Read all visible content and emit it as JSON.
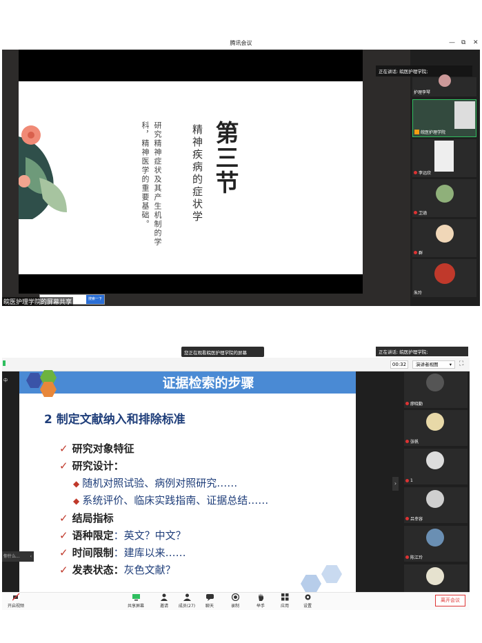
{
  "top_window": {
    "title": "腾讯会议",
    "window_controls": [
      "—",
      "⧉",
      "✕"
    ],
    "share_label": "皖医护理学院的屏幕共享",
    "mini_search_button": "搜索一下",
    "speaking": "正在讲话: 皖医护理学院;",
    "slide": {
      "chapter": "第三节",
      "title": "精神疾病的症状学",
      "description": "研究精神症状及其产生机制的学科，精神医学的重要基础。"
    },
    "participants": [
      {
        "name": "护理李琴"
      },
      {
        "name": "皖医护理学院"
      },
      {
        "name": "李远欣"
      },
      {
        "name": "卫涵"
      },
      {
        "name": "群"
      },
      {
        "name": "朱玲"
      }
    ]
  },
  "bottom_window": {
    "viewing_banner": "您正在观看皖医护理学院的屏幕",
    "speaking": "正在讲话: 皖医护理学院;",
    "timer": "00:32",
    "view_mode": "演讲者视图",
    "left_label": "中",
    "left_toast": "你什么...",
    "slide": {
      "header": "证据检索的步骤",
      "subtitle": "2 制定文献纳入和排除标准",
      "bullets": {
        "b1": "研究对象特征",
        "b2": "研究设计：",
        "b2a": "随机对照试验、病例对照研究……",
        "b2b": "系统评价、临床实践指南、证据总结……",
        "b3": "结局指标",
        "b4_label": "语种限定",
        "b4_value": "：英文？中文？",
        "b5_label": "时间限制",
        "b5_value": "：建库以来……",
        "b6_label": "发表状态：",
        "b6_value": "灰色文献？"
      }
    },
    "participants": [
      {
        "name": "廖晓勤"
      },
      {
        "name": "张帆"
      },
      {
        "name": "1"
      },
      {
        "name": "吕幸容"
      },
      {
        "name": "陈江玲"
      },
      {
        "name": ""
      }
    ],
    "toolbar": {
      "video": "开启视频",
      "share": "共享屏幕",
      "invite": "邀请",
      "members": "成员(27)",
      "chat": "聊天",
      "record": "录制",
      "raise_hand": "举手",
      "apps": "应用",
      "settings": "设置",
      "leave": "离开会议"
    },
    "colors": {
      "header_blue": "#4a8ad4",
      "check_red": "#c0392b",
      "leave_red": "#dd3333"
    }
  }
}
